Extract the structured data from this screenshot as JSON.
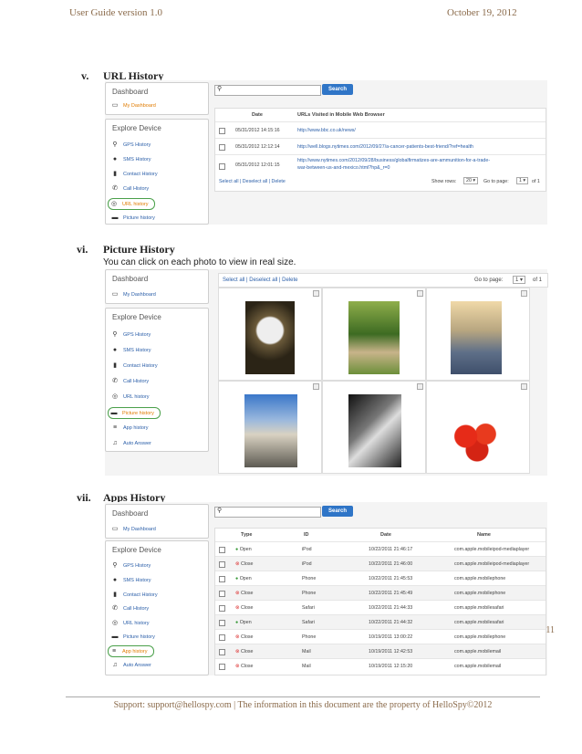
{
  "header": {
    "left": "User Guide version 1.0",
    "right": "October 19, 2012"
  },
  "page_number": "11",
  "footer": "Support: support@hellospy.com | The information in this document are the property of HelloSpy©2012",
  "sidebar": {
    "dashboard": "Dashboard",
    "my_dashboard": "My Dashboard",
    "explore": "Explore Device",
    "items": [
      "GPS History",
      "SMS History",
      "Contact History",
      "Call History",
      "URL history",
      "Picture history",
      "App history",
      "Auto Answer"
    ]
  },
  "search": {
    "button": "Search"
  },
  "sections": [
    {
      "num": "v.",
      "title": "URL History"
    },
    {
      "num": "vi.",
      "title": "Picture History",
      "desc": "You can click on each photo to view in real size."
    },
    {
      "num": "vii.",
      "title": "Apps History"
    }
  ],
  "url_table": {
    "headers": [
      "Date",
      "URLs Visited in Mobile Web Browser"
    ],
    "rows": [
      {
        "date": "05/31/2012 14:15:16",
        "url": "http://www.bbc.co.uk/news/"
      },
      {
        "date": "05/31/2012 12:12:14",
        "url": "http://well.blogs.nytimes.com/2012/09/27/a-cancer-patients-best-friend/?ref=health"
      },
      {
        "date": "05/31/2012 12:01:15",
        "url": "http://www.nytimes.com/2012/09/28/business/globalfirmatizes-are-ammunition-for-a-trade-",
        "url2": "war-between-us-and-mexico.html?hp&_r=0"
      }
    ],
    "actions": "Select all | Deselect all | Delete",
    "show_rows": "Show rows:",
    "rows_value": "20",
    "goto": "Go to page:",
    "page": "1",
    "of": "of 1"
  },
  "picture_bar": {
    "actions": "Select all | Deselect all | Delete",
    "goto": "Go to page:",
    "page": "1",
    "of": "of 1"
  },
  "apps_table": {
    "headers": [
      "Type",
      "ID",
      "Date",
      "Name"
    ],
    "rows": [
      {
        "type": "Open",
        "id": "iPod",
        "date": "10/22/2011 21:46:17",
        "name": "com.apple.mobileipod-mediaplayer"
      },
      {
        "type": "Close",
        "id": "iPod",
        "date": "10/22/2011 21:46:00",
        "name": "com.apple.mobileipod-mediaplayer"
      },
      {
        "type": "Open",
        "id": "Phone",
        "date": "10/22/2011 21:45:53",
        "name": "com.apple.mobilephone"
      },
      {
        "type": "Close",
        "id": "Phone",
        "date": "10/22/2011 21:45:49",
        "name": "com.apple.mobilephone"
      },
      {
        "type": "Close",
        "id": "Safari",
        "date": "10/22/2011 21:44:33",
        "name": "com.apple.mobilesafari"
      },
      {
        "type": "Open",
        "id": "Safari",
        "date": "10/22/2011 21:44:32",
        "name": "com.apple.mobilesafari"
      },
      {
        "type": "Close",
        "id": "Phone",
        "date": "10/19/2011 13:00:22",
        "name": "com.apple.mobilephone"
      },
      {
        "type": "Close",
        "id": "Mail",
        "date": "10/19/2011 12:42:53",
        "name": "com.apple.mobilemail"
      },
      {
        "type": "Close",
        "id": "Mail",
        "date": "10/19/2011 12:15:20",
        "name": "com.apple.mobilemail"
      }
    ]
  }
}
